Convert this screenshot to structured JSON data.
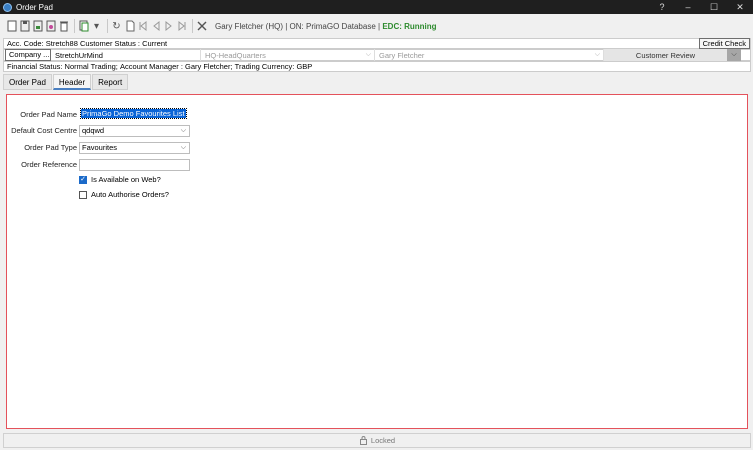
{
  "window": {
    "title": "Order Pad",
    "buttons": {
      "help": "?",
      "minimize": "–",
      "maximize": "☐",
      "close": "✕"
    }
  },
  "toolbar": {
    "status_prefix": "Gary Fletcher (HQ) | ON: PrimaGO Database |",
    "status_running": "EDC: Running",
    "icons": [
      "new-icon",
      "save-icon",
      "save-all-icon",
      "save-close-icon",
      "delete-icon",
      "copy-icon",
      "dropdown-arrow-icon",
      "refresh-icon",
      "blank-page-icon",
      "first-record-icon",
      "previous-record-icon",
      "next-record-icon",
      "last-record-icon",
      "cancel-icon"
    ]
  },
  "customer": {
    "acc_code": "Acc. Code: Stretch88",
    "status": "Customer Status : Current",
    "credit_check": "Credit Check",
    "company_button": "Company ...",
    "company_name": "StretchUrMind",
    "site": "HQ-HeadQuarters",
    "contact": "Gary Fletcher",
    "review": "Customer Review",
    "financial_status": "Financial Status: Normal Trading;",
    "account_manager": "Account Manager : Gary Fletcher;",
    "currency": "Trading Currency: GBP"
  },
  "tabs": [
    "Order Pad",
    "Header",
    "Report"
  ],
  "active_tab": "Header",
  "form": {
    "order_pad_name_label": "Order Pad Name",
    "order_pad_name_value": "PrimaGo Demo Favourites List",
    "cost_centre_label": "Default Cost Centre",
    "cost_centre_value": "qdqwd",
    "pad_type_label": "Order Pad Type",
    "pad_type_value": "Favourites",
    "order_ref_label": "Order Reference",
    "order_ref_value": "",
    "web_label": "Is Available on Web?",
    "web_checked": true,
    "auto_auth_label": "Auto Authorise Orders?",
    "auto_auth_checked": false
  },
  "statusbar": {
    "lock_text": "Locked"
  },
  "colors": {
    "accent": "#0a64d6",
    "frame_border": "#e4525b",
    "running": "#2e8b2e",
    "titlebar": "#1f1f1f"
  }
}
